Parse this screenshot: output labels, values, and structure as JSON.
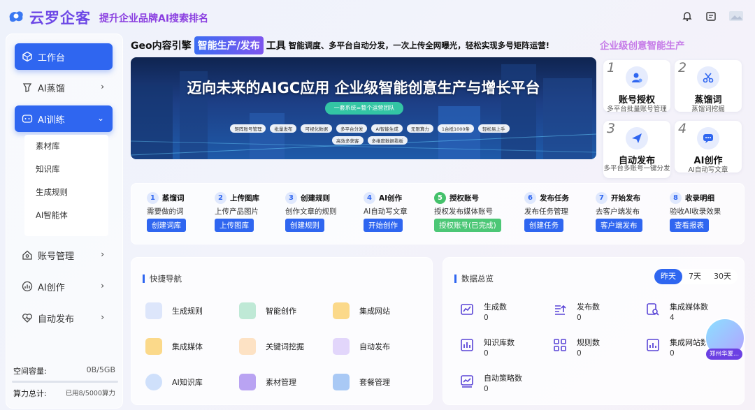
{
  "app": {
    "name": "云罗企客",
    "slogan": "提升企业品牌AI搜索排名"
  },
  "colors": {
    "primary": "#2f66f0",
    "accent": "#6d48e6",
    "success": "#4cc776"
  },
  "sidebar": {
    "items": [
      {
        "label": "工作台",
        "icon": "cube-icon",
        "active": true
      },
      {
        "label": "AI蒸馏",
        "icon": "distill-icon"
      },
      {
        "label": "AI训练",
        "icon": "train-icon",
        "active": true,
        "expanded": true
      },
      {
        "label": "账号管理",
        "icon": "home-icon"
      },
      {
        "label": "AI创作",
        "icon": "chart-icon"
      },
      {
        "label": "自动发布",
        "icon": "pulse-icon"
      }
    ],
    "submenu": [
      "素材库",
      "知识库",
      "生成规则",
      "AI智能体"
    ],
    "storage_label": "空间容量:",
    "storage_value": "0B/5GB",
    "compute_label": "算力总计:",
    "compute_value": "已用8/5000算力"
  },
  "headline": {
    "prefix": "Geo内容引擎",
    "tag": "智能生产/发布",
    "suffix": "工具",
    "desc": "智能调度、多平台自动分发，一次上传全网曝光，轻松实现多号矩阵运营!"
  },
  "banner": {
    "title": "迈向未来的AIGC应用  企业级智能创意生产与增长平台",
    "sub": "一套系统=整个运营团队",
    "chips": [
      "矩阵账号管理",
      "批量发布",
      "可视化数据",
      "多平台分发",
      "AI智能生成",
      "无限算力",
      "1台抵1000条",
      "轻松易上手",
      "高效多获客",
      "多维度数据看板"
    ]
  },
  "promo": {
    "title": "企业级创意智能生产",
    "cards": [
      {
        "num": "1",
        "title": "账号授权",
        "sub": "多平台批量账号管理"
      },
      {
        "num": "2",
        "title": "蒸馏词",
        "sub": "蒸馏词挖掘"
      },
      {
        "num": "3",
        "title": "自动发布",
        "sub": "多平台多账号一键分发"
      },
      {
        "num": "4",
        "title": "AI创作",
        "sub": "AI自动写文章"
      }
    ]
  },
  "steps": [
    {
      "num": "1",
      "title": "蒸馏词",
      "desc": "需要做的词",
      "btn": "创建词库"
    },
    {
      "num": "2",
      "title": "上传图库",
      "desc": "上传产品图片",
      "btn": "上传图库"
    },
    {
      "num": "3",
      "title": "创建规则",
      "desc": "创作文章的规则",
      "btn": "创建规则"
    },
    {
      "num": "4",
      "title": "AI创作",
      "desc": "AI自动写文章",
      "btn": "开始创作"
    },
    {
      "num": "5",
      "title": "授权账号",
      "desc": "授权发布媒体账号",
      "btn": "授权账号(已完成)",
      "done": true
    },
    {
      "num": "6",
      "title": "发布任务",
      "desc": "发布任务管理",
      "btn": "创建任务"
    },
    {
      "num": "7",
      "title": "开始发布",
      "desc": "去客户端发布",
      "btn": "客户端发布"
    },
    {
      "num": "8",
      "title": "收录明细",
      "desc": "验收AI收录效果",
      "btn": "查看报表"
    }
  ],
  "quick_nav": {
    "title": "快捷导航",
    "items": [
      "生成规则",
      "智能创作",
      "集成网站",
      "集成媒体",
      "关键词挖掘",
      "自动发布",
      "AI知识库",
      "素材管理",
      "套餐管理"
    ]
  },
  "overview": {
    "title": "数据总览",
    "tabs": [
      "昨天",
      "7天",
      "30天"
    ],
    "stats": [
      {
        "label": "生成数",
        "value": "0"
      },
      {
        "label": "发布数",
        "value": "0"
      },
      {
        "label": "集成媒体数",
        "value": "4"
      },
      {
        "label": "知识库数",
        "value": "0"
      },
      {
        "label": "规则数",
        "value": "0"
      },
      {
        "label": "集成网站数",
        "value": "0"
      },
      {
        "label": "自动策略数",
        "value": "0"
      }
    ]
  },
  "assistant": {
    "label": "郑州华厦..."
  }
}
